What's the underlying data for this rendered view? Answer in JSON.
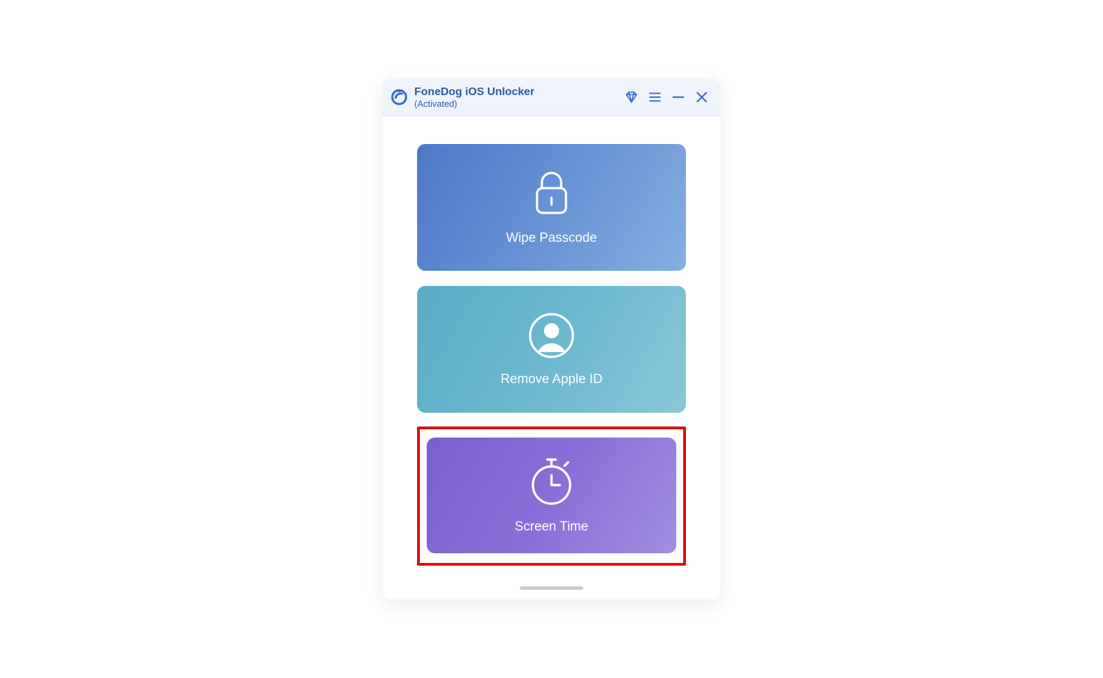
{
  "titlebar": {
    "app_title": "FoneDog iOS Unlocker",
    "status": "(Activated)"
  },
  "cards": {
    "wipe_passcode": {
      "label": "Wipe Passcode"
    },
    "remove_apple_id": {
      "label": "Remove Apple ID"
    },
    "screen_time": {
      "label": "Screen Time"
    }
  },
  "colors": {
    "brand": "#2a5aa8",
    "highlight_border": "#e30b0b"
  }
}
